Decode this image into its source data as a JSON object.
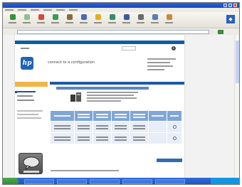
{
  "page": {
    "title": "connect to a configuration"
  },
  "browser": {
    "throbber_glyph": "◆"
  },
  "search": {
    "go_glyph": "»"
  },
  "hp": {
    "logo_text": "hp"
  },
  "colors": {
    "titlebar": "#1f55c8",
    "nav_blue": "#0f5ca6",
    "sidebar_header": "#f0b64b",
    "table_header": "#7fa6d6",
    "table_cell": "#e8eef7",
    "taskbar": "#2560cf",
    "start_button": "#3c9a3c"
  },
  "icons": [
    "back-icon",
    "forward-icon",
    "stop-icon",
    "refresh-icon",
    "home-icon",
    "search-icon",
    "favorites-icon",
    "history-icon",
    "mail-icon",
    "print-icon",
    "edit-icon",
    "discuss-icon"
  ]
}
